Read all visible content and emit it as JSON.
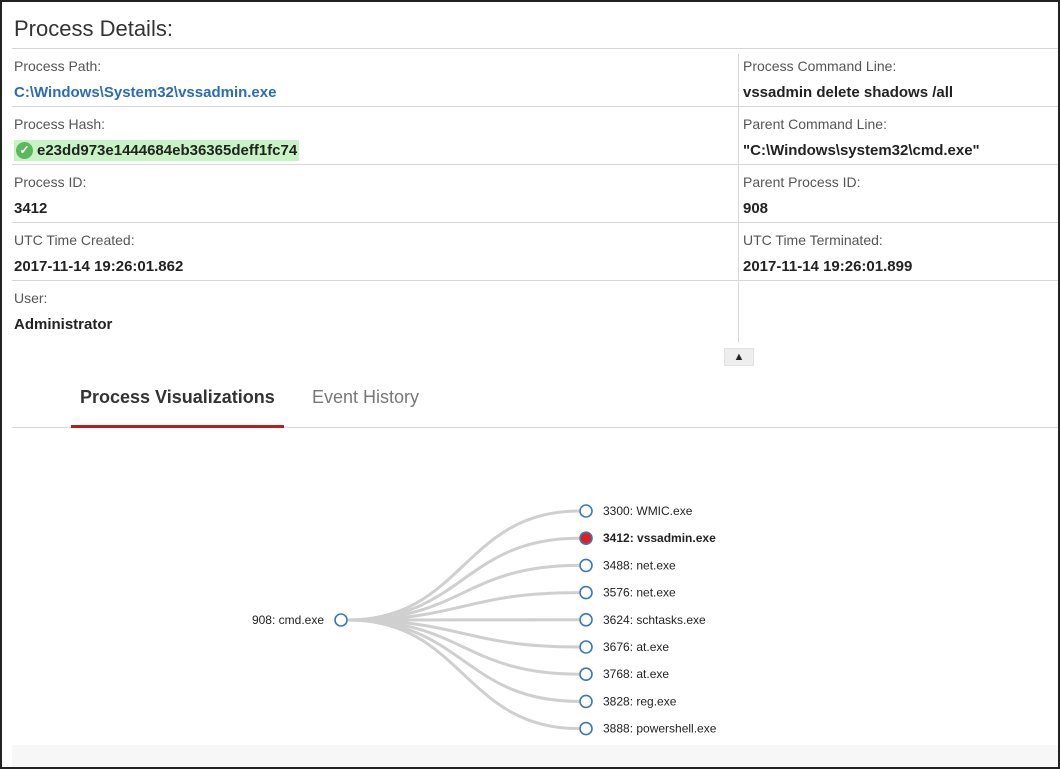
{
  "title": "Process Details:",
  "details": [
    {
      "left": {
        "label": "Process Path:",
        "value": "C:\\Windows\\System32\\vssadmin.exe"
      },
      "right": {
        "label": "Process Command Line:",
        "value": "vssadmin delete shadows /all"
      }
    },
    {
      "left": {
        "label": "Process Hash:",
        "value": "e23dd973e1444684eb36365deff1fc74"
      },
      "right": {
        "label": "Parent Command Line:",
        "value": "\"C:\\Windows\\system32\\cmd.exe\""
      }
    },
    {
      "left": {
        "label": "Process ID:",
        "value": "3412"
      },
      "right": {
        "label": "Parent Process ID:",
        "value": "908"
      }
    },
    {
      "left": {
        "label": "UTC Time Created:",
        "value": "2017-11-14 19:26:01.862"
      },
      "right": {
        "label": "UTC Time Terminated:",
        "value": "2017-11-14 19:26:01.899"
      }
    },
    {
      "left": {
        "label": "User:",
        "value": "Administrator"
      }
    }
  ],
  "colors": {
    "link": "#2a6db3",
    "hash_highlight": "#c8f3c4",
    "active_tab_underline": "#b22222",
    "node_stroke": "#3a78b5",
    "node_selected": "#e02020",
    "edge": "#cfcfcf"
  },
  "icons": {
    "hash_status": "check-circle-icon",
    "collapse": "chevron-up-icon"
  },
  "tabs": [
    {
      "label": "Process Visualizations",
      "active": true
    },
    {
      "label": "Event History",
      "active": false
    }
  ],
  "tree": {
    "root": {
      "label": "908: cmd.exe"
    },
    "children": [
      {
        "label": "3300: WMIC.exe",
        "selected": false
      },
      {
        "label": "3412: vssadmin.exe",
        "selected": true
      },
      {
        "label": "3488: net.exe",
        "selected": false
      },
      {
        "label": "3576: net.exe",
        "selected": false
      },
      {
        "label": "3624: schtasks.exe",
        "selected": false
      },
      {
        "label": "3676: at.exe",
        "selected": false
      },
      {
        "label": "3768: at.exe",
        "selected": false
      },
      {
        "label": "3828: reg.exe",
        "selected": false
      },
      {
        "label": "3888: powershell.exe",
        "selected": false
      }
    ]
  }
}
